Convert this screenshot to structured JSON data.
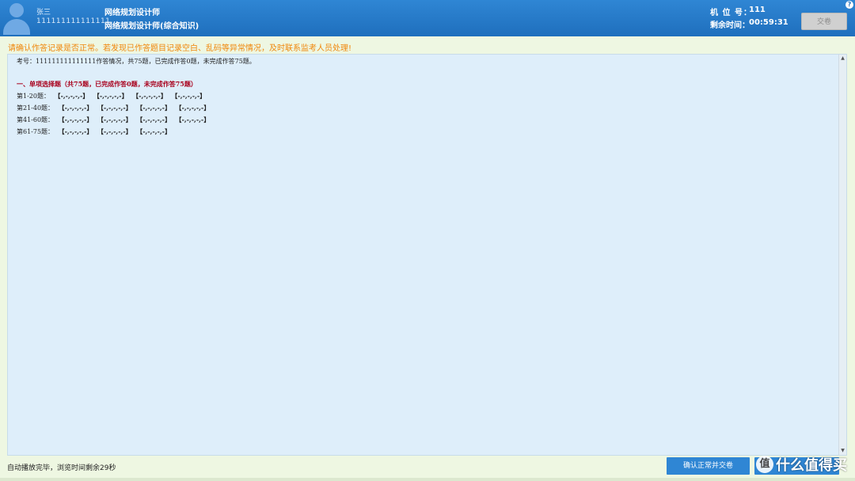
{
  "header": {
    "user_name": "张三",
    "user_id": "111111111111111",
    "exam_title": "网络规划设计师",
    "exam_subtitle": "网络规划设计师(综合知识)",
    "seat_label": "机 位 号：",
    "seat_value": "111",
    "time_label": "剩余时间：",
    "time_value": "00:59:31",
    "submit_label": "交卷",
    "help_label": "?"
  },
  "warning": "请确认作答记录是否正常。若发现已作答题目记录空白、乱码等异常情况，及时联系监考人员处理!",
  "record": {
    "summary": "考号：111111111111111作答情况，共75题，已完成作答0题，未完成作答75题。",
    "section_title": "一、单项选择题（共75题，已完成作答0题，未完成作答75题）",
    "rows": [
      {
        "label": "第1-20题：",
        "groups": [
          "【-,-,-,-,-】",
          "【-,-,-,-,-】",
          "【-,-,-,-,-】",
          "【-,-,-,-,-】"
        ]
      },
      {
        "label": "第21-40题：",
        "groups": [
          "【-,-,-,-,-】",
          "【-,-,-,-,-】",
          "【-,-,-,-,-】",
          "【-,-,-,-,-】"
        ]
      },
      {
        "label": "第41-60题：",
        "groups": [
          "【-,-,-,-,-】",
          "【-,-,-,-,-】",
          "【-,-,-,-,-】",
          "【-,-,-,-,-】"
        ]
      },
      {
        "label": "第61-75题：",
        "groups": [
          "【-,-,-,-,-】",
          "【-,-,-,-,-】",
          "【-,-,-,-,-】"
        ]
      }
    ]
  },
  "footer": {
    "status": "自动播放完毕，浏览时间剩余29秒",
    "confirm_label": "确认正常并交卷",
    "watermark_badge": "值",
    "watermark_text": "什么值得买"
  },
  "colors": {
    "header_blue": "#1f6fbd",
    "warning_orange": "#f0860a",
    "section_red": "#a8001c",
    "panel_bg": "#deeefa",
    "page_bg": "#eef7e2"
  },
  "icons": {
    "avatar": "user-avatar-icon",
    "help": "help-icon",
    "scroll_up": "scroll-up-arrow-icon",
    "scroll_down": "scroll-down-arrow-icon"
  }
}
